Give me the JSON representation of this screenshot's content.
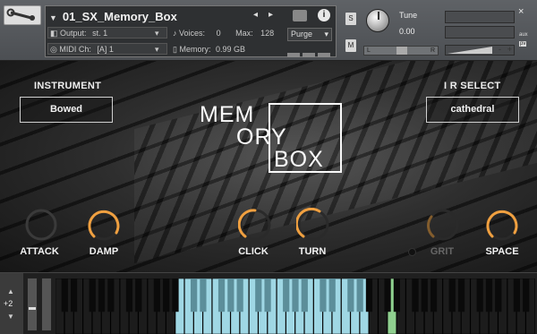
{
  "header": {
    "instrument_name": "01_SX_Memory_Box",
    "output_label": "Output:",
    "output_value": "st. 1",
    "midi_label": "MIDI Ch:",
    "midi_value": "[A]  1",
    "voices_label": "Voices:",
    "voices_value": "0",
    "max_label": "Max:",
    "max_value": "128",
    "memory_label": "Memory:",
    "memory_value": "0.99 GB",
    "purge_label": "Purge",
    "solo_label": "S",
    "mute_label": "M",
    "tune_label": "Tune",
    "tune_value": "0.00",
    "pan_left": "L",
    "pan_right": "R",
    "close_label": "×",
    "aux_label": "aux",
    "pv_label": "pv",
    "vol_minus": "-",
    "vol_plus": "+"
  },
  "stage": {
    "instrument_section_label": "INSTRUMENT",
    "instrument_value": "Bowed",
    "ir_section_label": "I R SELECT",
    "ir_value": "cathedral",
    "logo_line1": "MEM",
    "logo_line2": "ORY",
    "logo_line3": "BOX",
    "knobs": [
      {
        "label": "ATTACK",
        "active": false
      },
      {
        "label": "DAMP",
        "active": true
      },
      {
        "label": "CLICK",
        "active": true
      },
      {
        "label": "TURN",
        "active": true
      },
      {
        "label": "GRIT",
        "active": false
      },
      {
        "label": "SPACE",
        "active": true
      }
    ],
    "knob_accent": "#f0a040",
    "knob_inactive": "#3a3a3a"
  },
  "keyboard": {
    "octave_up": "▲",
    "octave_value": "+2",
    "octave_down": "▼",
    "mapped_color": "#9fd7e4",
    "key_switch_color": "#8fd08f"
  }
}
